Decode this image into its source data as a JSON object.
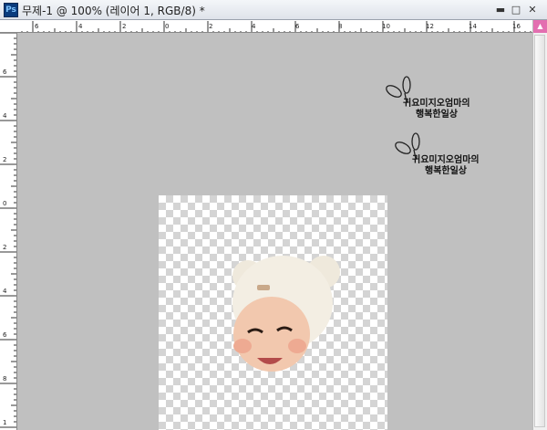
{
  "window": {
    "app_icon": "Ps",
    "title": "무제-1 @ 100% (레이어 1, RGB/8) *",
    "minimize_label": "▬",
    "restore_label": "□",
    "close_label": "✕"
  },
  "rulers": {
    "horizontal": [
      "6",
      "4",
      "2",
      "0",
      "2",
      "4",
      "6",
      "8",
      "10",
      "12",
      "14",
      "16"
    ],
    "vertical": [
      "6",
      "4",
      "2",
      "0",
      "2",
      "4",
      "6",
      "8",
      "1"
    ]
  },
  "watermarks": [
    {
      "line1": "귀요미지오엄마의",
      "line2": "행복한일상"
    },
    {
      "line1": "귀요미지오엄마의",
      "line2": "행복한일상"
    }
  ],
  "icons": [
    "photoshop-app-icon",
    "minimize-icon",
    "restore-icon",
    "close-icon",
    "leaf-sprout-icon",
    "scroll-up-arrow-icon"
  ],
  "colors": {
    "canvas_bg": "#c0c0c0",
    "scroll_accent": "#e36fb0",
    "checker": "#d4d4d4"
  }
}
